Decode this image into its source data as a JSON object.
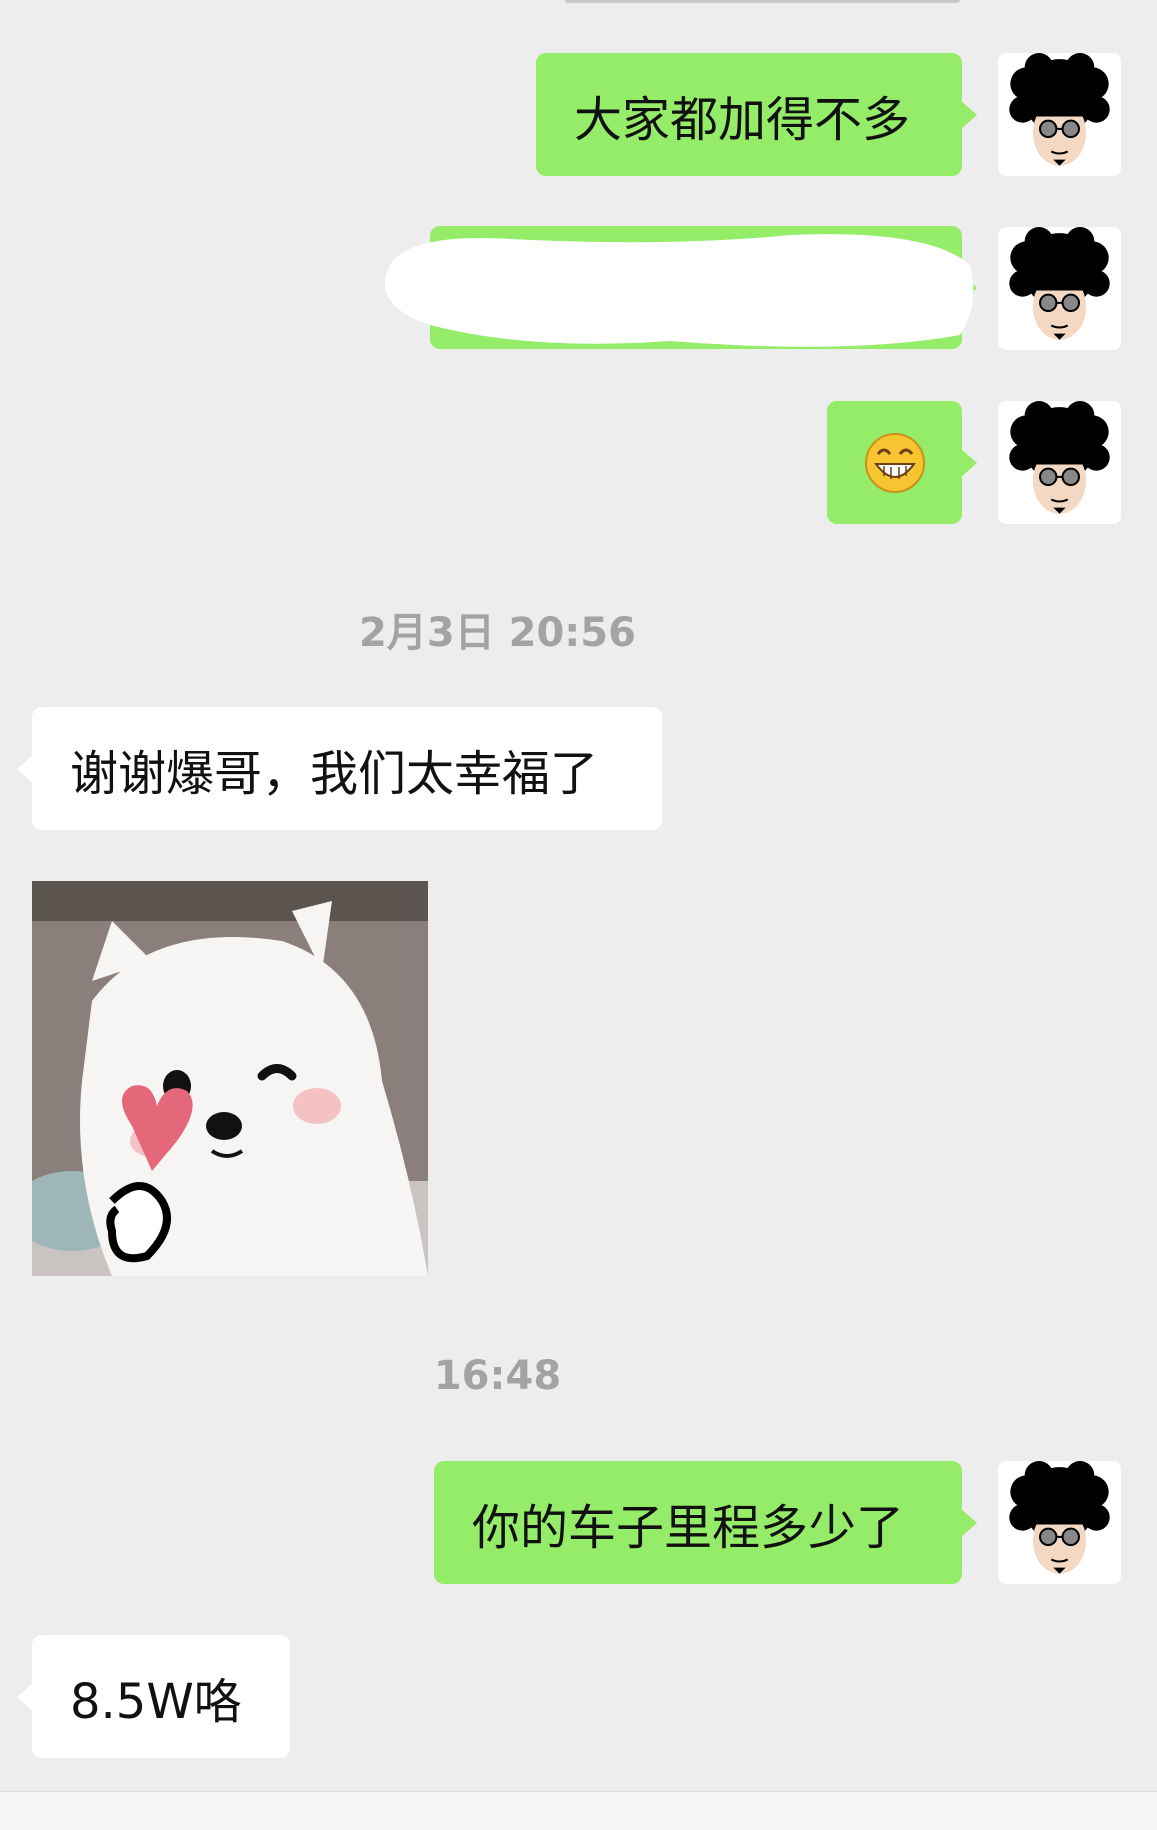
{
  "messages": [
    {
      "side": "out",
      "text": "大家都加得不多"
    },
    {
      "side": "out",
      "redacted": true
    },
    {
      "side": "out",
      "emoji": "grin-emoji"
    },
    {
      "side": "in",
      "text": "谢谢爆哥，我们太幸福了"
    },
    {
      "side": "in",
      "sticker": "pomeranian-heart-sticker"
    },
    {
      "side": "out",
      "text": "你的车子里程多少了"
    },
    {
      "side": "in",
      "text": "8.5W咯"
    }
  ],
  "timestamps": [
    "2月3日 20:56",
    "16:48"
  ],
  "colors": {
    "background": "#ededed",
    "out_bubble": "#95ec69",
    "in_bubble": "#ffffff",
    "timestamp": "#a3a3a3"
  },
  "icons": {
    "avatar": "afro-sunglasses-avatar-icon",
    "emoji": "grin-emoji-icon"
  }
}
